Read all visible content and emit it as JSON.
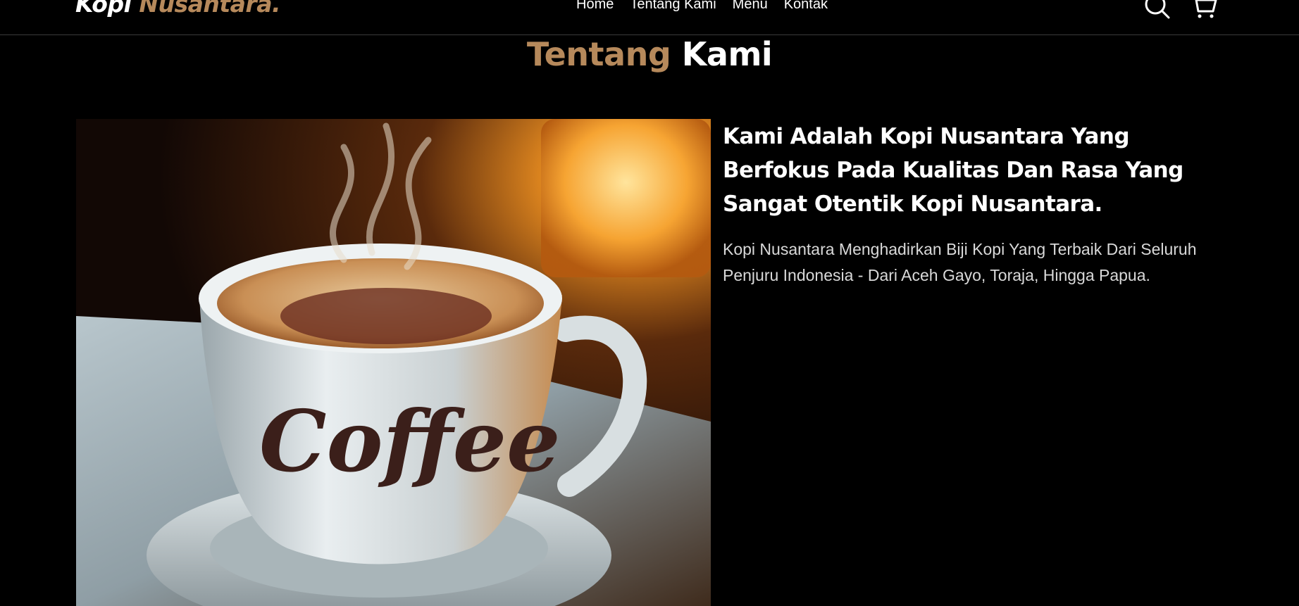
{
  "navbar": {
    "logo_part1": "Kopi",
    "logo_part2": "Nusantara.",
    "links": [
      "Home",
      "Tentang Kami",
      "Menu",
      "Kontak"
    ],
    "icons": [
      "search-icon",
      "shopping-cart-icon"
    ]
  },
  "about": {
    "title_part1": "Tentang",
    "title_part2": "Kami",
    "image_text": "Coffee",
    "heading": "Kami Adalah Kopi Nusantara Yang Berfokus Pada Kualitas Dan Rasa Yang Sangat Otentik Kopi Nusantara.",
    "text": "Kopi Nusantara Menghadirkan Biji Kopi Yang Terbaik Dari Seluruh Penjuru Indonesia - Dari Aceh Gayo, Toraja, Hingga Papua."
  },
  "colors": {
    "background": "#000000",
    "accent": "#b6895b",
    "text": "#ffffff"
  }
}
